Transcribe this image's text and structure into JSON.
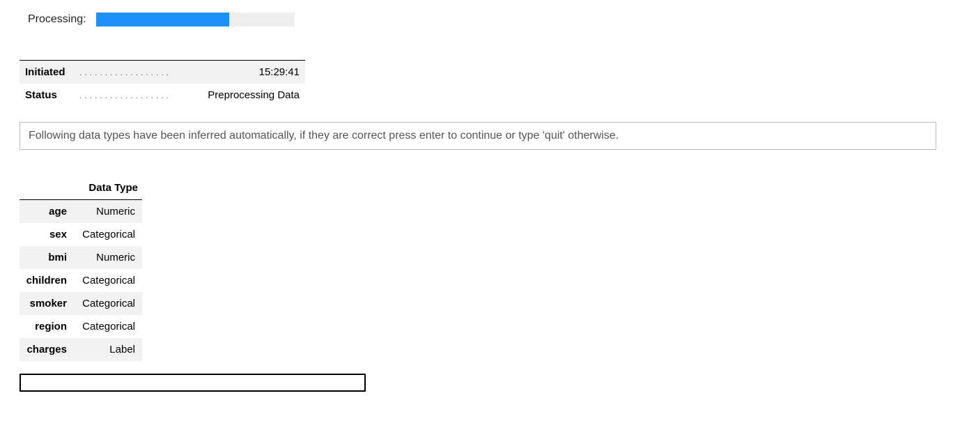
{
  "processing": {
    "label": "Processing:",
    "progress_percent": 67
  },
  "status_table": [
    {
      "key": "Initiated",
      "value": "15:29:41"
    },
    {
      "key": "Status",
      "value": "Preprocessing Data"
    }
  ],
  "info_message": "Following data types have been inferred automatically, if they are correct press enter to continue or type 'quit' otherwise.",
  "dtype_header": {
    "blank": "",
    "col": "Data Type"
  },
  "dtype_rows": [
    {
      "name": "age",
      "type": "Numeric"
    },
    {
      "name": "sex",
      "type": "Categorical"
    },
    {
      "name": "bmi",
      "type": "Numeric"
    },
    {
      "name": "children",
      "type": "Categorical"
    },
    {
      "name": "smoker",
      "type": "Categorical"
    },
    {
      "name": "region",
      "type": "Categorical"
    },
    {
      "name": "charges",
      "type": "Label"
    }
  ],
  "prompt": {
    "value": "",
    "placeholder": ""
  }
}
